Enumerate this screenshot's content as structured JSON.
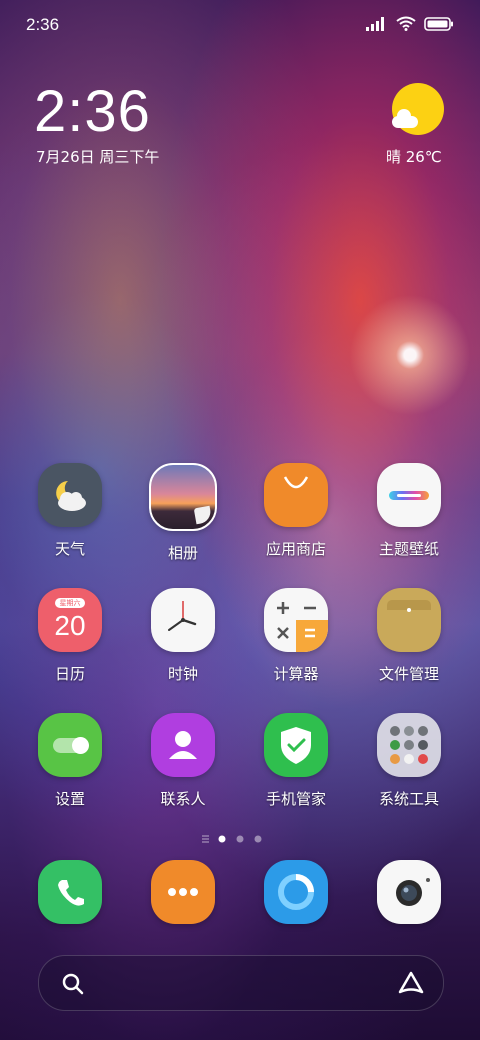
{
  "status_bar": {
    "time": "2:36"
  },
  "clock_widget": {
    "time": "2:36",
    "date": "7月26日 周三下午",
    "weather": "晴 26℃"
  },
  "apps": [
    {
      "label": "天气"
    },
    {
      "label": "相册"
    },
    {
      "label": "应用商店"
    },
    {
      "label": "主题壁纸"
    },
    {
      "label": "日历"
    },
    {
      "label": "时钟"
    },
    {
      "label": "计算器"
    },
    {
      "label": "文件管理"
    },
    {
      "label": "设置"
    },
    {
      "label": "联系人"
    },
    {
      "label": "手机管家"
    },
    {
      "label": "系统工具"
    }
  ],
  "calendar_icon": {
    "weekday": "星期六",
    "day": "20"
  },
  "page_indicator": {
    "pages": 3,
    "current": 1
  },
  "dock": [
    "phone-icon",
    "messages-icon",
    "browser-icon",
    "camera-icon"
  ],
  "colors": {
    "weather_sun": "#fcd113",
    "settings": "#58c445",
    "contacts": "#b03ee0",
    "security": "#2fbf4e",
    "store": "#f08a2a"
  }
}
